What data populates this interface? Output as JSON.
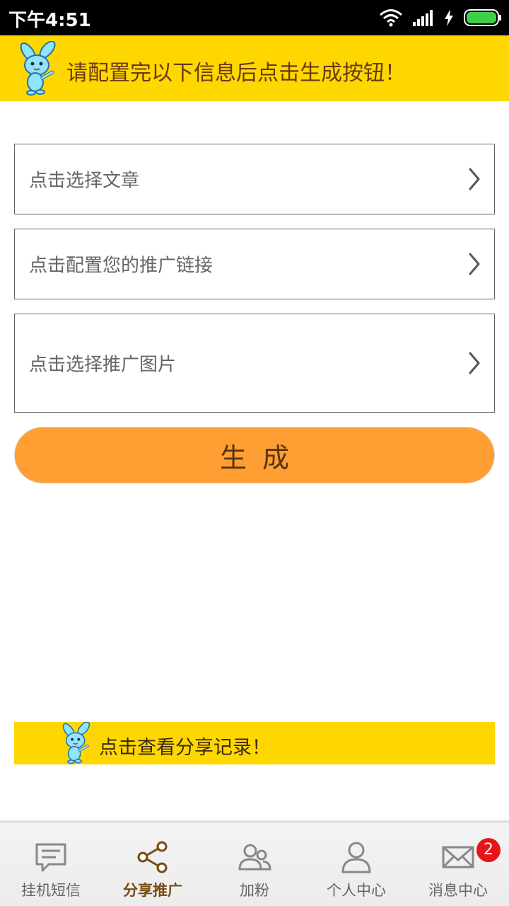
{
  "status_bar": {
    "time": "下午4:51",
    "icons": [
      "wifi-icon",
      "signal-icon",
      "charging-icon",
      "battery-icon"
    ]
  },
  "header_banner": {
    "text": "请配置完以下信息后点击生成按钮！",
    "background": "#ffd700",
    "icon": "bunny-mascot-icon"
  },
  "form": {
    "rows": [
      {
        "label": "点击选择文章",
        "icon": "chevron-right-icon"
      },
      {
        "label": "点击配置您的推广链接",
        "icon": "chevron-right-icon"
      },
      {
        "label": "点击选择推广图片",
        "icon": "chevron-right-icon"
      }
    ],
    "generate_label": "生成",
    "generate_color": "#ff9f33"
  },
  "history_banner": {
    "text": "点击查看分享记录！",
    "icon": "bunny-mascot-icon"
  },
  "bottom_nav": {
    "items": [
      {
        "label": "挂机短信",
        "icon": "message-icon",
        "active": false
      },
      {
        "label": "分享推广",
        "icon": "share-icon",
        "active": true
      },
      {
        "label": "加粉",
        "icon": "users-icon",
        "active": false
      },
      {
        "label": "个人中心",
        "icon": "person-icon",
        "active": false
      },
      {
        "label": "消息中心",
        "icon": "mail-icon",
        "active": false,
        "badge": "2"
      }
    ],
    "active_color": "#7a4a10",
    "badge_color": "#e8141a"
  }
}
